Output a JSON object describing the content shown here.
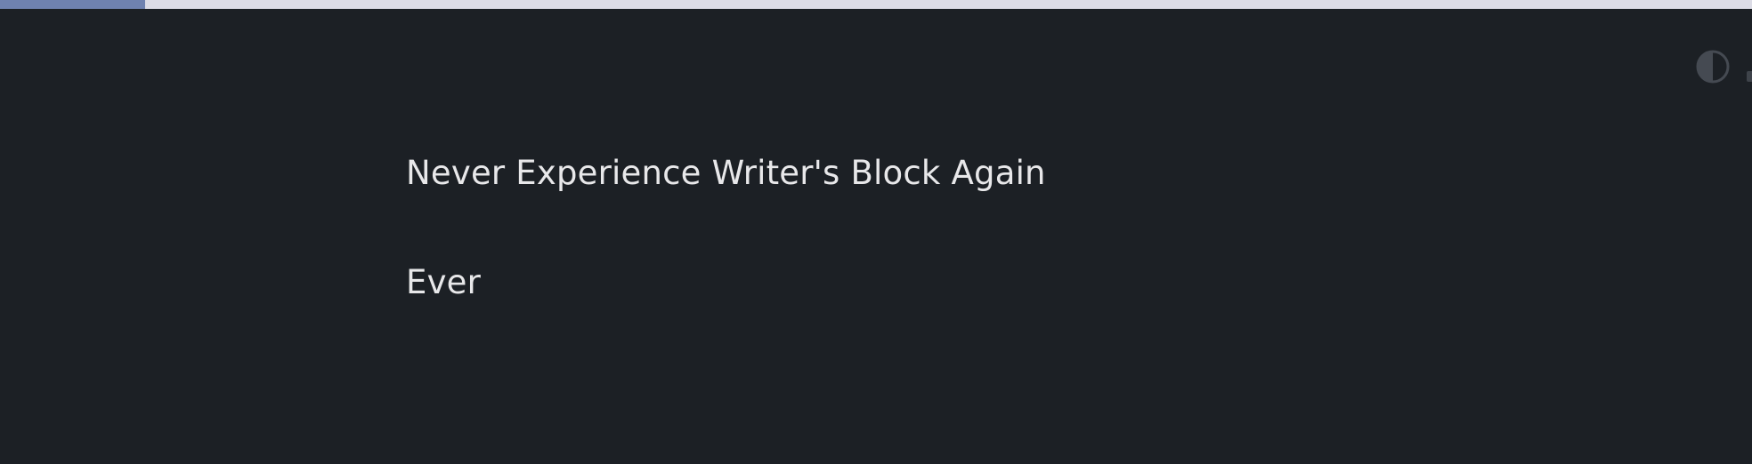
{
  "progress": {
    "fraction": 0.083,
    "fill_color": "#6f82b0",
    "track_color": "#dcdce6"
  },
  "toolbar": {
    "theme_toggle_icon": "contrast-icon"
  },
  "editor": {
    "lines": [
      "Never Experience Writer's Block Again",
      "Ever"
    ]
  },
  "colors": {
    "background": "#1c2025",
    "text": "#e8e8ea",
    "icon": "#454a52"
  }
}
